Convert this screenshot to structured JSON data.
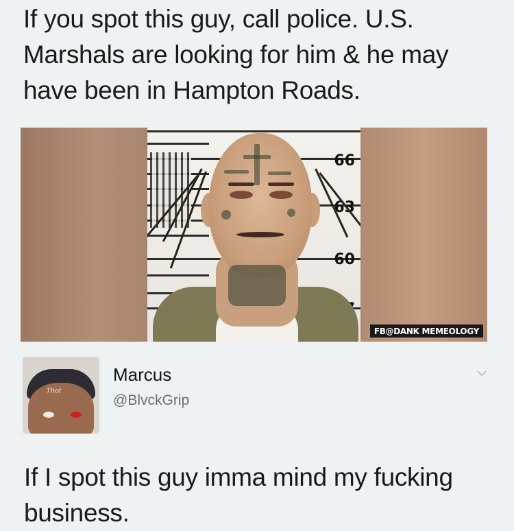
{
  "post": {
    "headline": "If you spot this guy, call police. U.S. Marshals are looking for him & he may have been in Hampton Roads.",
    "photo": {
      "height_marks": [
        "66",
        "63",
        "60",
        "7"
      ],
      "watermark": "FB@DANK MEMEOLOGY"
    }
  },
  "tweet": {
    "name": "Marcus",
    "handle": "@BlvckGrip",
    "avatar_caption": "Thot",
    "text": "If I spot this guy imma mind my fucking business."
  },
  "colors": {
    "background": "#eef2f3",
    "text": "#1a1a1a",
    "handle": "#6c6f72"
  }
}
